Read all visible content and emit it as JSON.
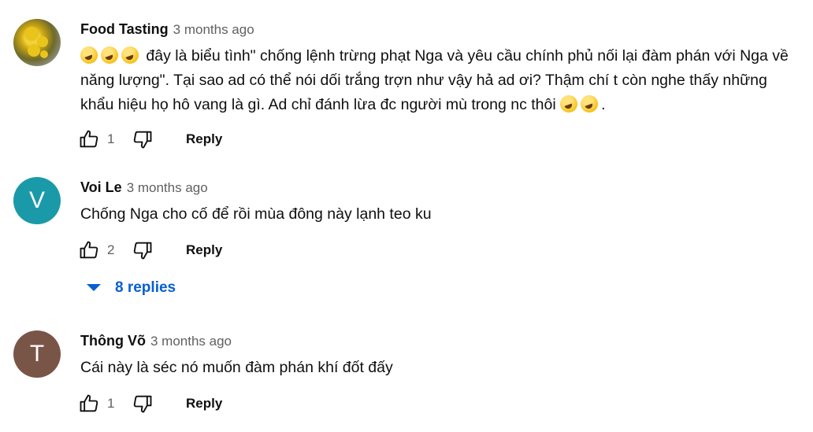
{
  "comments": [
    {
      "author": "Food Tasting",
      "time": "3 months ago",
      "text_main": "đây là biểu tình\" chống lệnh trừng phạt Nga và yêu cầu chính phủ nối lại đàm phán với Nga về năng lượng\". Tại sao ad có thể nói dối trắng trợn như vậy hả ad ơi? Thậm chí t còn nghe thấy những khẩu hiệu họ hô vang là gì. Ad chỉ đánh lừa đc người mù trong nc thôi",
      "text_tail": ".",
      "likes": "1",
      "reply_label": "Reply"
    },
    {
      "author": "Voi Le",
      "avatar_letter": "V",
      "time": "3 months ago",
      "text": "Chống Nga cho cố để rồi mùa đông này lạnh teo ku",
      "likes": "2",
      "reply_label": "Reply"
    },
    {
      "author": "Thông Võ",
      "avatar_letter": "T",
      "time": "3 months ago",
      "text": "Cái này là séc nó muốn đàm phán khí đốt đấy",
      "likes": "1",
      "reply_label": "Reply"
    }
  ],
  "replies_toggle": {
    "label": "8 replies"
  },
  "colors": {
    "voi_le_avatar": "#1a9aa8",
    "thong_vo_avatar": "#795548",
    "link_blue": "#065fd4",
    "meta_gray": "#606060"
  },
  "icons": {
    "like": "thumbs-up-icon",
    "dislike": "thumbs-down-icon",
    "expand": "caret-down-icon",
    "emoji": "rolling-on-floor-laughing-emoji"
  }
}
